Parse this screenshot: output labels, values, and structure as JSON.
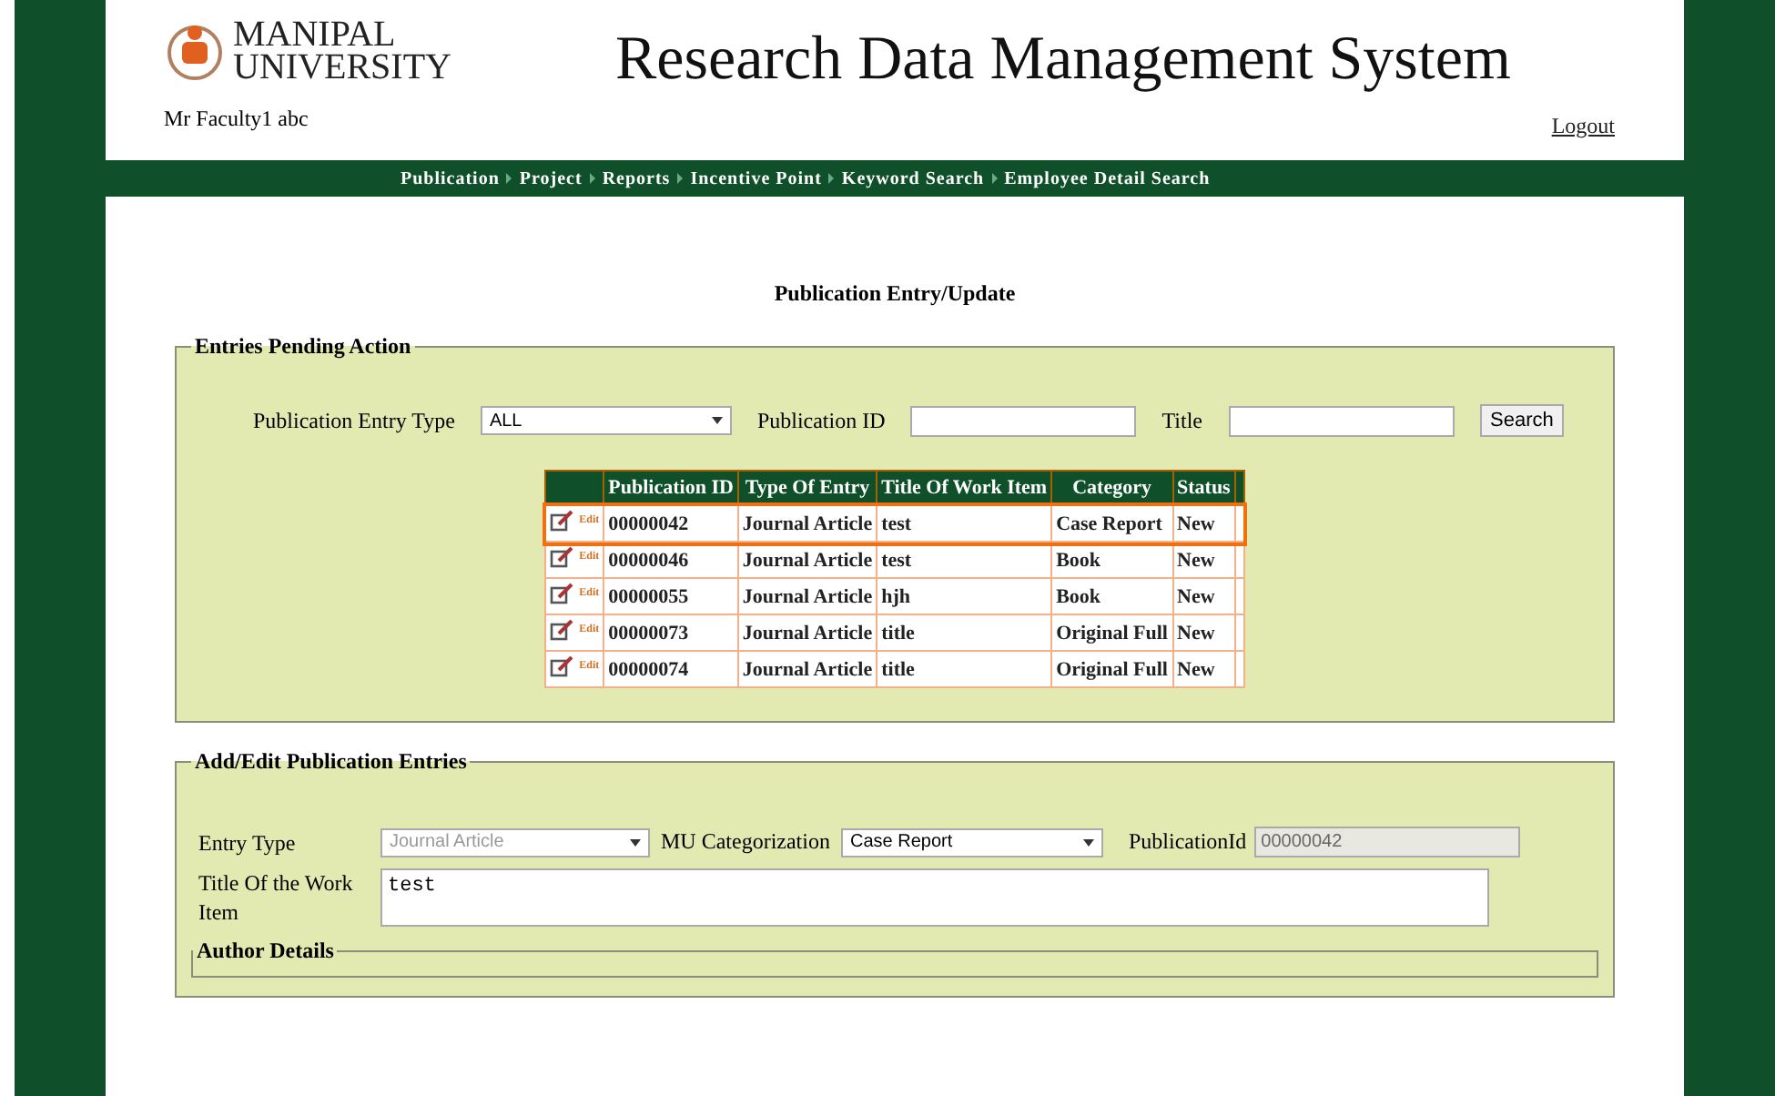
{
  "header": {
    "logo_line1": "MANIPAL",
    "logo_line2": "UNIVERSITY",
    "title": "Research Data Management System",
    "user": "Mr Faculty1 abc",
    "logout": "Logout"
  },
  "nav": [
    "Publication",
    "Project",
    "Reports",
    "Incentive Point",
    "Keyword Search",
    "Employee Detail Search"
  ],
  "page_title": "Publication Entry/Update",
  "pending": {
    "legend": "Entries Pending Action",
    "filters": {
      "entry_type_label": "Publication Entry Type",
      "entry_type_value": "ALL",
      "id_label": "Publication ID",
      "title_label": "Title",
      "search_button": "Search"
    },
    "table": {
      "columns": [
        "Publication ID",
        "Type Of Entry",
        "Title Of Work Item",
        "Category",
        "Status"
      ],
      "rows": [
        {
          "action": "Edit",
          "cells": [
            "00000042",
            "Journal Article",
            "test",
            "Case Report",
            "New"
          ],
          "selected": true
        },
        {
          "action": "Edit",
          "cells": [
            "00000046",
            "Journal Article",
            "test",
            "Book",
            "New"
          ],
          "selected": false
        },
        {
          "action": "Edit",
          "cells": [
            "00000055",
            "Journal Article",
            "hjh",
            "Book",
            "New"
          ],
          "selected": false
        },
        {
          "action": "Edit",
          "cells": [
            "00000073",
            "Journal Article",
            "title",
            "Original Full",
            "New"
          ],
          "selected": false
        },
        {
          "action": "Edit",
          "cells": [
            "00000074",
            "Journal Article",
            "title",
            "Original Full",
            "New"
          ],
          "selected": false
        }
      ]
    }
  },
  "edit": {
    "legend": "Add/Edit Publication Entries",
    "entry_type_label": "Entry Type",
    "entry_type_value": "Journal Article",
    "entry_type_disabled": true,
    "mu_label": "MU Categorization",
    "mu_value": "Case Report",
    "pubid_label": "PublicationId",
    "pubid_value": "00000042",
    "title_label": "Title Of the Work Item",
    "title_value": "test",
    "author_legend": "Author Details"
  }
}
